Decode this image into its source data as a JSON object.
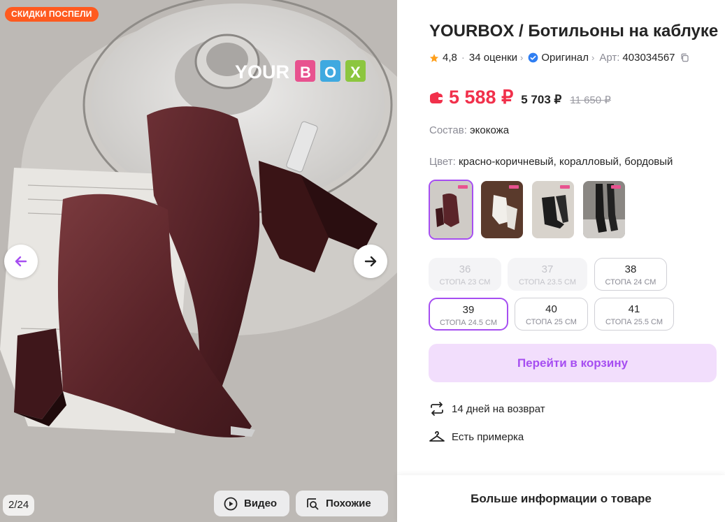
{
  "gallery": {
    "promo_badge": "СКИДКИ ПОСПЕЛИ",
    "watermark_brand": "YOURBOX",
    "counter": "2/24",
    "video_label": "Видео",
    "similar_label": "Похожие",
    "prev_icon": "arrow-left-icon",
    "next_icon": "arrow-right-icon"
  },
  "product": {
    "title": "YOURBOX / Ботильоны на каблуке",
    "rating": "4,8",
    "reviews": "34 оценки",
    "original_label": "Оригинал",
    "article_label": "Арт:",
    "article": "403034567",
    "price_current": "5 588 ₽",
    "price_wallet": "5 703 ₽",
    "price_old": "11 650 ₽",
    "composition_label": "Состав:",
    "composition": "экокожа",
    "color_label": "Цвет:",
    "colors": "красно-коричневый, коралловый, бордовый",
    "selected_color_index": 0,
    "sizes": [
      {
        "size": "36",
        "foot": "СТОПА 23 СМ",
        "state": "disabled"
      },
      {
        "size": "37",
        "foot": "СТОПА 23.5 СМ",
        "state": "disabled"
      },
      {
        "size": "38",
        "foot": "СТОПА 24 СМ",
        "state": "available"
      },
      {
        "size": "39",
        "foot": "СТОПА 24.5 СМ",
        "state": "selected"
      },
      {
        "size": "40",
        "foot": "СТОПА 25 СМ",
        "state": "available"
      },
      {
        "size": "41",
        "foot": "СТОПА 25.5 СМ",
        "state": "available"
      }
    ],
    "cart_button": "Перейти в корзину",
    "return_text": "14 дней на возврат",
    "fitting_text": "Есть примерка",
    "more_info": "Больше информации о товаре"
  },
  "colors": {
    "accent": "#a64ef1",
    "price_red": "#f1304b",
    "badge_orange": "#ff5a1f",
    "cart_bg": "#f2defc"
  }
}
